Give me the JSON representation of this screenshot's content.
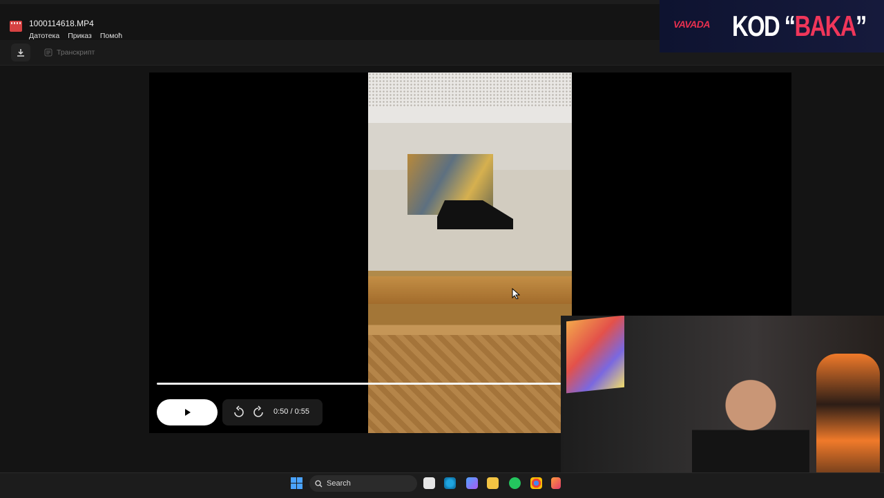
{
  "app": {
    "file_name": "1000114618.MP4",
    "menu": [
      "Датотека",
      "Приказ",
      "Помоћ"
    ]
  },
  "toolbar": {
    "download_icon": "download-icon",
    "transcript_label": "Транскрипт"
  },
  "ad": {
    "brand": "VAVADA",
    "code_text": "KOD “",
    "code_value": "BAKA",
    "code_close": "”"
  },
  "player": {
    "time": "0:50 / 0:55",
    "progress": 0.91,
    "play_icon": "play-icon",
    "rewind_icon": "rewind-10-icon",
    "forward_icon": "forward-10-icon"
  },
  "taskbar": {
    "search_placeholder": "Search"
  },
  "colors": {
    "accent": "#f0365a",
    "windows_blue": "#4aa3ff"
  }
}
